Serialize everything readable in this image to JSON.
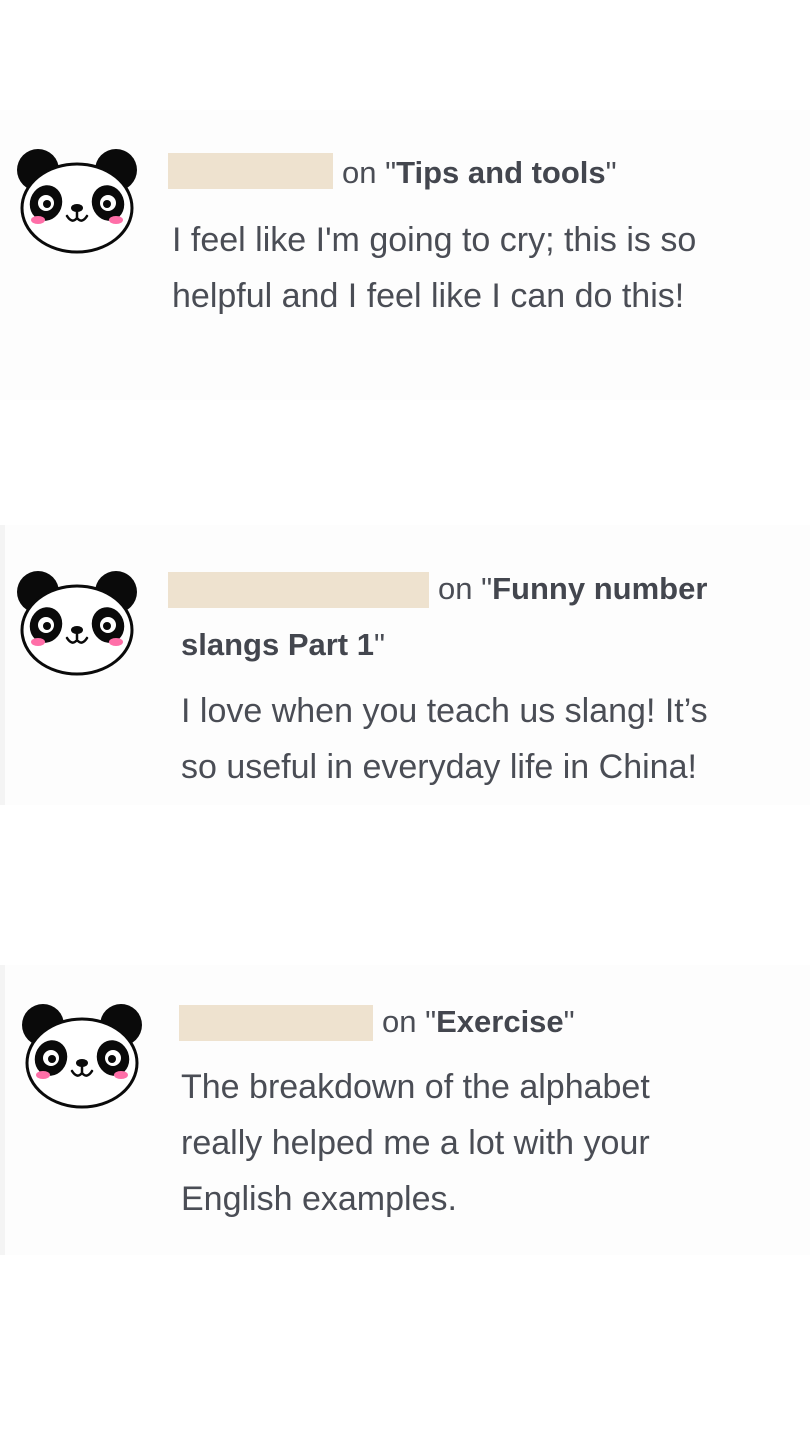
{
  "colors": {
    "text": "#4a4d55",
    "redaction": "#eee2cf",
    "background": "#ffffff",
    "panda_black": "#0a0a0a",
    "panda_cheek": "#ff6fa8"
  },
  "comments": [
    {
      "avatar_icon": "panda-avatar-icon",
      "on_prefix": "on \"",
      "topic": "Tips and tools",
      "on_suffix": "\"",
      "text_lines": [
        "I feel like I'm going to cry; this is so",
        "helpful and I feel like I can do this!"
      ]
    },
    {
      "avatar_icon": "panda-avatar-icon",
      "on_prefix": "on \"",
      "topic_line1": "Funny number",
      "topic_line2": "slangs Part 1",
      "on_suffix": "\"",
      "text_lines": [
        "I love when you teach us slang! It’s",
        "so useful in everyday life in China!"
      ]
    },
    {
      "avatar_icon": "panda-avatar-icon",
      "on_prefix": "on \"",
      "topic": "Exercise",
      "on_suffix": "\"",
      "text_lines": [
        "The breakdown of the alphabet",
        "really helped me a lot with your",
        "English examples."
      ]
    }
  ]
}
